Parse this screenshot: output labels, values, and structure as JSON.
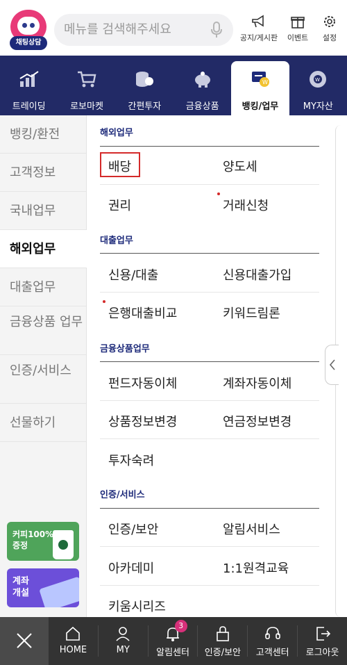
{
  "top": {
    "chat_label": "채팅상담",
    "search_placeholder": "메뉴를 검색해주세요",
    "actions": [
      {
        "label": "공지/게시판",
        "icon": "megaphone-icon"
      },
      {
        "label": "이벤트",
        "icon": "gift-icon"
      },
      {
        "label": "설정",
        "icon": "gear-icon"
      }
    ]
  },
  "categories": [
    {
      "label": "트레이딩",
      "icon": "chart-icon"
    },
    {
      "label": "로보마켓",
      "icon": "cart-icon"
    },
    {
      "label": "간편투자",
      "icon": "coins-icon"
    },
    {
      "label": "금융상품",
      "icon": "piggy-bank-icon"
    },
    {
      "label": "뱅킹/업무",
      "icon": "banking-icon",
      "active": true
    },
    {
      "label": "MY자산",
      "icon": "asset-icon"
    }
  ],
  "sidebar": {
    "items": [
      "뱅킹/환전",
      "고객정보",
      "국내업무",
      "해외업무",
      "대출업무",
      "금융상품 업무",
      "인증/서비스",
      "선물하기"
    ],
    "active": "해외업무",
    "banner_coffee": "커피100% 증정",
    "banner_account": "계좌 개설"
  },
  "sections": [
    {
      "title": "해외업무",
      "rows": [
        [
          "배당",
          "양도세"
        ],
        [
          "권리",
          "거래신청"
        ]
      ]
    },
    {
      "title": "대출업무",
      "rows": [
        [
          "신용/대출",
          "신용대출가입"
        ],
        [
          "은행대출비교",
          "키워드림론"
        ]
      ]
    },
    {
      "title": "금융상품업무",
      "rows": [
        [
          "펀드자동이체",
          "계좌자동이체"
        ],
        [
          "상품정보변경",
          "연금정보변경"
        ],
        [
          "투자숙려",
          ""
        ]
      ]
    },
    {
      "title": "인증/서비스",
      "rows": [
        [
          "인증/보안",
          "알림서비스"
        ],
        [
          "아카데미",
          "1:1원격교육"
        ],
        [
          "키움시리즈",
          ""
        ]
      ]
    }
  ],
  "bottom": {
    "items": [
      {
        "label": "HOME",
        "icon": "home-icon"
      },
      {
        "label": "MY",
        "icon": "person-icon"
      },
      {
        "label": "알림센터",
        "icon": "bell-icon",
        "badge": "3"
      },
      {
        "label": "인증/보안",
        "icon": "lock-icon"
      },
      {
        "label": "고객센터",
        "icon": "headset-icon"
      },
      {
        "label": "로그아웃",
        "icon": "logout-icon"
      }
    ]
  },
  "colors": {
    "nav": "#222a66",
    "accent": "#e83a78",
    "highlight": "#d42a2a",
    "bottom": "#333333"
  }
}
